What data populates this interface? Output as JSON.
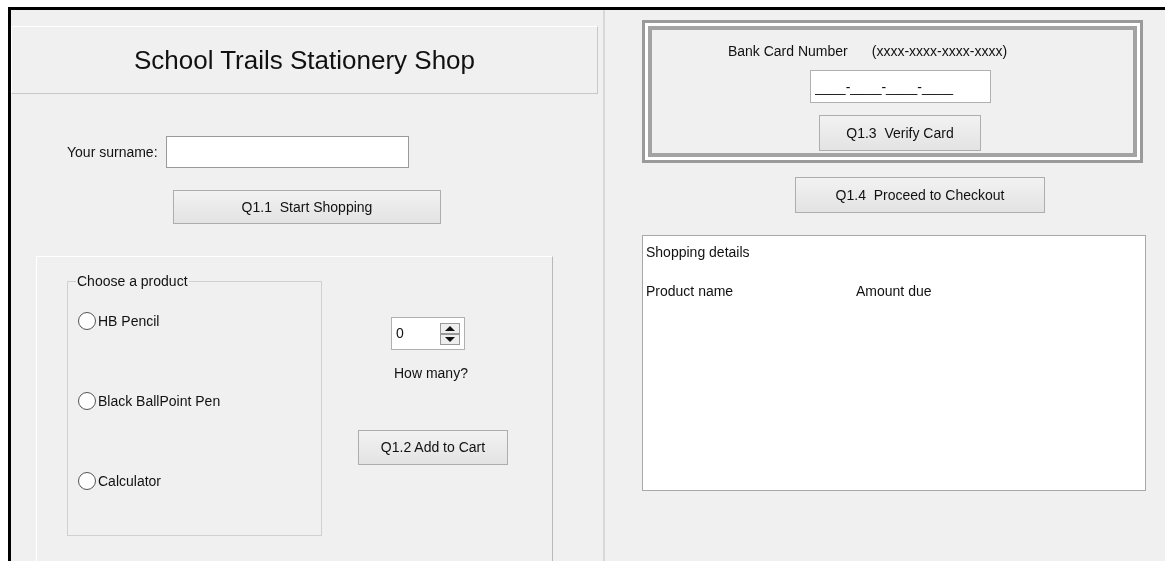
{
  "title": "School Trails Stationery Shop",
  "surname": {
    "label": "Your surname:"
  },
  "start_button": "Q1.1  Start Shopping",
  "product_group": {
    "title": "Choose a product",
    "options": [
      {
        "label": "HB Pencil",
        "selected": false
      },
      {
        "label": "Black BallPoint Pen",
        "selected": false
      },
      {
        "label": "Calculator",
        "selected": false
      }
    ]
  },
  "quantity": {
    "value": "0",
    "label": "How many?"
  },
  "add_button": "Q1.2 Add to Cart",
  "card": {
    "label": "Bank Card Number",
    "format": "(xxxx-xxxx-xxxx-xxxx)",
    "value": "____-____-____-____"
  },
  "verify_button": "Q1.3  Verify Card",
  "checkout_button": "Q1.4  Proceed to Checkout",
  "details": {
    "title": "Shopping details",
    "columns": [
      "Product name",
      "Amount due"
    ]
  }
}
